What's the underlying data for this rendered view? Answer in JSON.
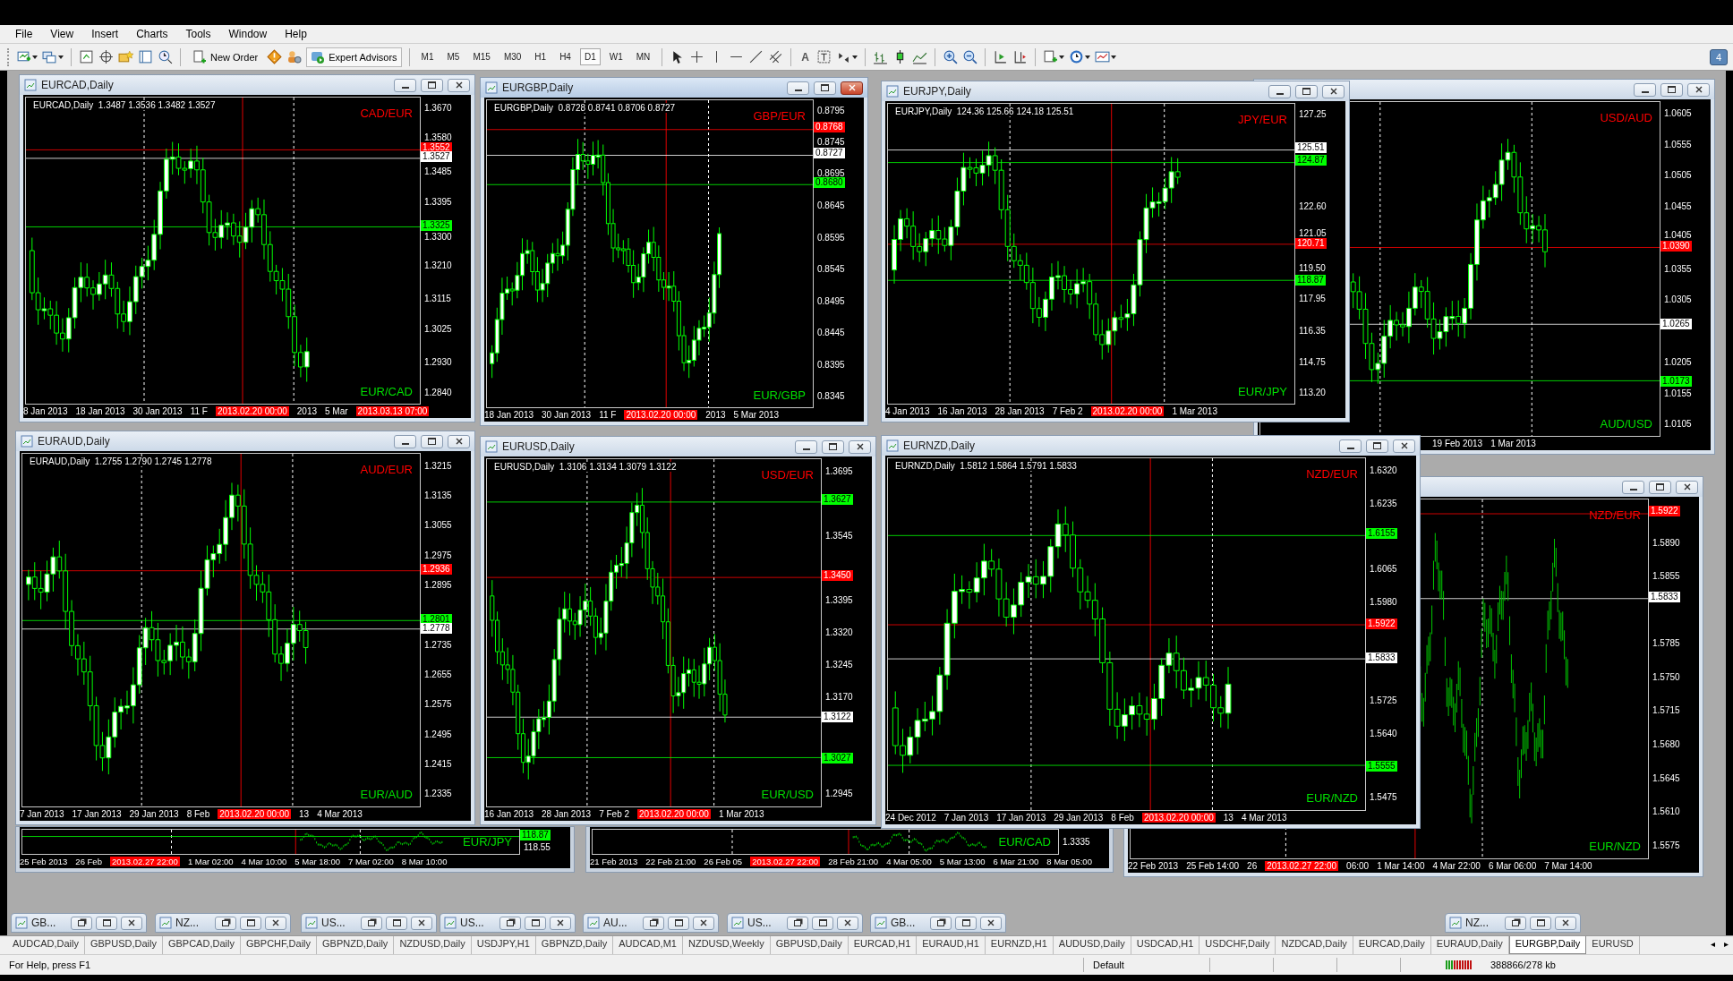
{
  "menu": [
    "File",
    "View",
    "Insert",
    "Charts",
    "Tools",
    "Window",
    "Help"
  ],
  "toolbar": {
    "new_order": "New Order",
    "expert_advisors": "Expert Advisors",
    "text_tool": "A",
    "notifications": "4",
    "timeframes": [
      {
        "label": "M1",
        "selected": false
      },
      {
        "label": "M5",
        "selected": false
      },
      {
        "label": "M15",
        "selected": false
      },
      {
        "label": "M30",
        "selected": false
      },
      {
        "label": "H1",
        "selected": false
      },
      {
        "label": "H4",
        "selected": false
      },
      {
        "label": "D1",
        "selected": true
      },
      {
        "label": "W1",
        "selected": false
      },
      {
        "label": "MN",
        "selected": false
      }
    ]
  },
  "windows": [
    {
      "kind": "window",
      "title": "EURCAD,Daily",
      "active": false,
      "info": "EURCAD,Daily  1.3487 1.3536 1.3482 1.3527",
      "pair_top": "CAD/EUR",
      "pair_bottom": "EUR/CAD",
      "ticks": [
        "1.3670",
        "1.3580",
        "1.3485",
        "1.3395",
        "1.3300",
        "1.3210",
        "1.3115",
        "1.3025",
        "1.2930",
        "1.2840"
      ],
      "tags": [
        {
          "value": "1.3552",
          "color": "#ff0000"
        },
        {
          "value": "1.3527",
          "color": "#ffffff"
        },
        {
          "value": "1.3325",
          "color": "#00ff00"
        }
      ],
      "dates": [
        {
          "text": "8 Jan 2013",
          "marker": false
        },
        {
          "text": "18 Jan 2013",
          "marker": false
        },
        {
          "text": "30 Jan 2013",
          "marker": false
        },
        {
          "text": "11 F",
          "marker": false
        },
        {
          "text": "2013.02.20 00:00",
          "marker": true
        },
        {
          "text": "2013",
          "marker": false
        },
        {
          "text": "5 Mar",
          "marker": false
        },
        {
          "text": "2013.03.13 07:00",
          "marker": true
        }
      ]
    },
    {
      "kind": "window",
      "title": "EURGBP,Daily",
      "active": true,
      "info": "EURGBP,Daily  0.8728 0.8741 0.8706 0.8727",
      "pair_top": "GBP/EUR",
      "pair_bottom": "EUR/GBP",
      "ticks": [
        "0.8795",
        "0.8745",
        "0.8695",
        "0.8645",
        "0.8595",
        "0.8545",
        "0.8495",
        "0.8445",
        "0.8395",
        "0.8345"
      ],
      "tags": [
        {
          "value": "0.8768",
          "color": "#ff0000"
        },
        {
          "value": "0.8727",
          "color": "#ffffff"
        },
        {
          "value": "0.8680",
          "color": "#00ff00"
        }
      ],
      "dates": [
        {
          "text": "18 Jan 2013",
          "marker": false
        },
        {
          "text": "30 Jan 2013",
          "marker": false
        },
        {
          "text": "11 F",
          "marker": false
        },
        {
          "text": "2013.02.20 00:00",
          "marker": true
        },
        {
          "text": "2013",
          "marker": false
        },
        {
          "text": "5 Mar 2013",
          "marker": false
        }
      ]
    },
    {
      "kind": "window",
      "title": "EURJPY,Daily",
      "active": false,
      "info": "EURJPY,Daily  124.36 125.66 124.18 125.51",
      "pair_top": "JPY/EUR",
      "pair_bottom": "EUR/JPY",
      "ticks": [
        "127.25",
        "122.60",
        "121.05",
        "119.50",
        "117.95",
        "116.35",
        "114.75",
        "113.20"
      ],
      "tags": [
        {
          "value": "125.51",
          "color": "#ffffff"
        },
        {
          "value": "124.87",
          "color": "#00ff00"
        },
        {
          "value": "120.71",
          "color": "#ff0000"
        },
        {
          "value": "118.87",
          "color": "#00ff00"
        }
      ],
      "dates": [
        {
          "text": "4 Jan 2013",
          "marker": false
        },
        {
          "text": "16 Jan 2013",
          "marker": false
        },
        {
          "text": "28 Jan 2013",
          "marker": false
        },
        {
          "text": "7 Feb 2",
          "marker": false
        },
        {
          "text": "2013.02.20 00:00",
          "marker": true
        },
        {
          "text": "1 Mar 2013",
          "marker": false
        }
      ]
    },
    {
      "kind": "window",
      "active": false,
      "pair_top": "USD/AUD",
      "pair_bottom": "AUD/USD",
      "ticks": [
        "1.0605",
        "1.0555",
        "1.0505",
        "1.0455",
        "1.0405",
        "1.0355",
        "1.0305",
        "1.0205",
        "1.0155",
        "1.0105"
      ],
      "tags": [
        {
          "value": "1.0390",
          "color": "#ff0000"
        },
        {
          "value": "1.0265",
          "color": "#ffffff"
        },
        {
          "value": "1.0173",
          "color": "#00ff00"
        }
      ],
      "dates": [
        {
          "text": "19 Feb 2013",
          "marker": false
        },
        {
          "text": "1 Mar 2013",
          "marker": false
        }
      ]
    },
    {
      "kind": "window",
      "title": "EURAUD,Daily",
      "active": false,
      "info": "EURAUD,Daily  1.2755 1.2790 1.2745 1.2778",
      "pair_top": "AUD/EUR",
      "pair_bottom": "EUR/AUD",
      "ticks": [
        "1.3215",
        "1.3135",
        "1.3055",
        "1.2975",
        "1.2895",
        "1.2735",
        "1.2655",
        "1.2575",
        "1.2495",
        "1.2415",
        "1.2335"
      ],
      "tags": [
        {
          "value": "1.2936",
          "color": "#ff0000"
        },
        {
          "value": "1.2801",
          "color": "#00ff00"
        },
        {
          "value": "1.2778",
          "color": "#ffffff"
        }
      ],
      "dates": [
        {
          "text": "7 Jan 2013",
          "marker": false
        },
        {
          "text": "17 Jan 2013",
          "marker": false
        },
        {
          "text": "29 Jan 2013",
          "marker": false
        },
        {
          "text": "8 Feb",
          "marker": false
        },
        {
          "text": "2013.02.20 00:00",
          "marker": true
        },
        {
          "text": "13",
          "marker": false
        },
        {
          "text": "4 Mar 2013",
          "marker": false
        }
      ]
    },
    {
      "kind": "window",
      "title": "EURUSD,Daily",
      "active": false,
      "info": "EURUSD,Daily  1.3106 1.3134 1.3079 1.3122",
      "pair_top": "USD/EUR",
      "pair_bottom": "EUR/USD",
      "ticks": [
        "1.3695",
        "1.3545",
        "1.3395",
        "1.3320",
        "1.3245",
        "1.3170",
        "1.2945"
      ],
      "tags": [
        {
          "value": "1.3627",
          "color": "#00ff00"
        },
        {
          "value": "1.3450",
          "color": "#ff0000"
        },
        {
          "value": "1.3122",
          "color": "#ffffff"
        },
        {
          "value": "1.3027",
          "color": "#00ff00"
        }
      ],
      "dates": [
        {
          "text": "16 Jan 2013",
          "marker": false
        },
        {
          "text": "28 Jan 2013",
          "marker": false
        },
        {
          "text": "7 Feb 2",
          "marker": false
        },
        {
          "text": "2013.02.20 00:00",
          "marker": true
        },
        {
          "text": "1 Mar 2013",
          "marker": false
        }
      ]
    },
    {
      "kind": "window",
      "title": "EURNZD,Daily",
      "active": false,
      "info": "EURNZD,Daily  1.5812 1.5864 1.5791 1.5833",
      "pair_top": "NZD/EUR",
      "pair_bottom": "EUR/NZD",
      "ticks": [
        "1.6320",
        "1.6235",
        "1.6065",
        "1.5980",
        "1.5725",
        "1.5640",
        "1.5475"
      ],
      "tags": [
        {
          "value": "1.6155",
          "color": "#00ff00"
        },
        {
          "value": "1.5922",
          "color": "#ff0000"
        },
        {
          "value": "1.5833",
          "color": "#ffffff"
        },
        {
          "value": "1.5555",
          "color": "#00ff00"
        }
      ],
      "dates": [
        {
          "text": "24 Dec 2012",
          "marker": false
        },
        {
          "text": "7 Jan 2013",
          "marker": false
        },
        {
          "text": "17 Jan 2013",
          "marker": false
        },
        {
          "text": "29 Jan 2013",
          "marker": false
        },
        {
          "text": "8 Feb",
          "marker": false
        },
        {
          "text": "2013.02.20 00:00",
          "marker": true
        },
        {
          "text": "13",
          "marker": false
        },
        {
          "text": "4 Mar 2013",
          "marker": false
        }
      ]
    },
    {
      "kind": "window",
      "active": false,
      "pair_top": "NZD/EUR",
      "pair_bottom": "EUR/NZD",
      "ticks": [
        "1.5890",
        "1.5855",
        "1.5785",
        "1.5750",
        "1.5715",
        "1.5680",
        "1.5645",
        "1.5610",
        "1.5575"
      ],
      "tags": [
        {
          "value": "1.5922",
          "color": "#ff0000"
        },
        {
          "value": "1.5833",
          "color": "#ffffff"
        }
      ],
      "dates": [
        {
          "text": "22 Feb 2013",
          "marker": false
        },
        {
          "text": "25 Feb 14:00",
          "marker": false
        },
        {
          "text": "26",
          "marker": false
        },
        {
          "text": "2013.02.27 22:00",
          "marker": true
        },
        {
          "text": "06:00",
          "marker": false
        },
        {
          "text": "1 Mar 14:00",
          "marker": false
        },
        {
          "text": "4 Mar 22:00",
          "marker": false
        },
        {
          "text": "6 Mar 06:00",
          "marker": false
        },
        {
          "text": "7 Mar 14:00",
          "marker": false
        }
      ]
    },
    {
      "kind": "strip",
      "pair_bottom": "EUR/JPY",
      "ticks": [
        "118.55"
      ],
      "tags": [
        {
          "value": "118.87",
          "color": "#00ff00"
        }
      ],
      "dates": [
        {
          "text": "25 Feb 2013",
          "marker": false
        },
        {
          "text": "26 Feb",
          "marker": false
        },
        {
          "text": "2013.02.27 22:00",
          "marker": true
        },
        {
          "text": "1 Mar 02:00",
          "marker": false
        },
        {
          "text": "4 Mar 10:00",
          "marker": false
        },
        {
          "text": "5 Mar 18:00",
          "marker": false
        },
        {
          "text": "7 Mar 02:00",
          "marker": false
        },
        {
          "text": "8 Mar 10:00",
          "marker": false
        }
      ]
    },
    {
      "kind": "strip",
      "pair_bottom": "EUR/CAD",
      "ticks": [
        "1.3335"
      ],
      "dates": [
        {
          "text": "21 Feb 2013",
          "marker": false
        },
        {
          "text": "22 Feb 21:00",
          "marker": false
        },
        {
          "text": "26 Feb 05",
          "marker": false
        },
        {
          "text": "2013.02.27 22:00",
          "marker": true
        },
        {
          "text": "28 Feb 21:00",
          "marker": false
        },
        {
          "text": "4 Mar 05:00",
          "marker": false
        },
        {
          "text": "5 Mar 13:00",
          "marker": false
        },
        {
          "text": "6 Mar 21:00",
          "marker": false
        },
        {
          "text": "8 Mar 05:00",
          "marker": false
        }
      ]
    }
  ],
  "minimized": [
    {
      "title": "GB..."
    },
    {
      "title": "NZ..."
    },
    {
      "title": "US..."
    },
    {
      "title": "US..."
    },
    {
      "title": "AU..."
    },
    {
      "title": "US..."
    },
    {
      "title": "GB..."
    },
    {
      "title": "NZ..."
    }
  ],
  "tabs": [
    {
      "label": "AUDCAD,Daily",
      "selected": false
    },
    {
      "label": "GBPUSD,Daily",
      "selected": false
    },
    {
      "label": "GBPCAD,Daily",
      "selected": false
    },
    {
      "label": "GBPCHF,Daily",
      "selected": false
    },
    {
      "label": "GBPNZD,Daily",
      "selected": false
    },
    {
      "label": "NZDUSD,Daily",
      "selected": false
    },
    {
      "label": "USDJPY,H1",
      "selected": false
    },
    {
      "label": "GBPNZD,Daily",
      "selected": false
    },
    {
      "label": "AUDCAD,M1",
      "selected": false
    },
    {
      "label": "NZDUSD,Weekly",
      "selected": false
    },
    {
      "label": "GBPUSD,Daily",
      "selected": false
    },
    {
      "label": "EURCAD,H1",
      "selected": false
    },
    {
      "label": "EURAUD,H1",
      "selected": false
    },
    {
      "label": "EURNZD,H1",
      "selected": false
    },
    {
      "label": "AUDUSD,Daily",
      "selected": false
    },
    {
      "label": "USDCAD,H1",
      "selected": false
    },
    {
      "label": "USDCHF,Daily",
      "selected": false
    },
    {
      "label": "NZDCAD,Daily",
      "selected": false
    },
    {
      "label": "EURCAD,Daily",
      "selected": false
    },
    {
      "label": "EURAUD,Daily",
      "selected": false
    },
    {
      "label": "EURGBP,Daily",
      "selected": true
    },
    {
      "label": "EURUSD",
      "selected": false
    }
  ],
  "tab_scroll": [
    "◂",
    "▸"
  ],
  "status_bar": {
    "help": "For Help, press F1",
    "profile": "Default",
    "traffic": "388866/278 kb"
  }
}
